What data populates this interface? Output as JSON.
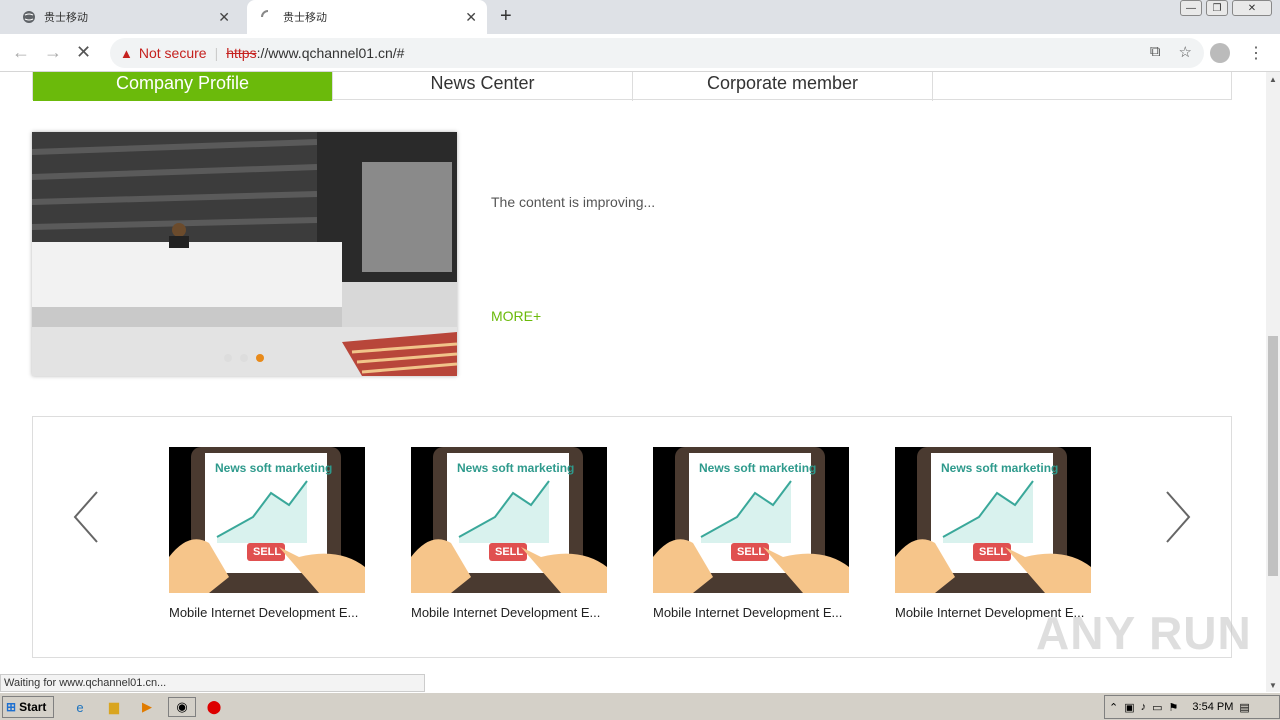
{
  "browser": {
    "tabs": [
      {
        "title": "贵士移动",
        "active": false
      },
      {
        "title": "贵士移动",
        "active": true
      }
    ],
    "toolbar": {
      "security_label": "Not secure",
      "url_scheme": "https",
      "url_rest": "://www.qchannel01.cn/#"
    },
    "status_text": "Waiting for www.qchannel01.cn..."
  },
  "page": {
    "nav_tabs": [
      "Company Profile",
      "News Center",
      "Corporate member"
    ],
    "intro_text": "The content is improving...",
    "more_label": "MORE+",
    "carousel_dots_active_index": 2,
    "cards": [
      {
        "image_text": "News soft marketing",
        "sell_text": "SELL",
        "title": "Mobile Internet Development E..."
      },
      {
        "image_text": "News soft marketing",
        "sell_text": "SELL",
        "title": "Mobile Internet Development E..."
      },
      {
        "image_text": "News soft marketing",
        "sell_text": "SELL",
        "title": "Mobile Internet Development E..."
      },
      {
        "image_text": "News soft marketing",
        "sell_text": "SELL",
        "title": "Mobile Internet Development E..."
      }
    ],
    "accent_color": "#6bba0b"
  },
  "watermark": "ANY RUN",
  "taskbar": {
    "start_label": "Start",
    "clock": "3:54 PM"
  }
}
